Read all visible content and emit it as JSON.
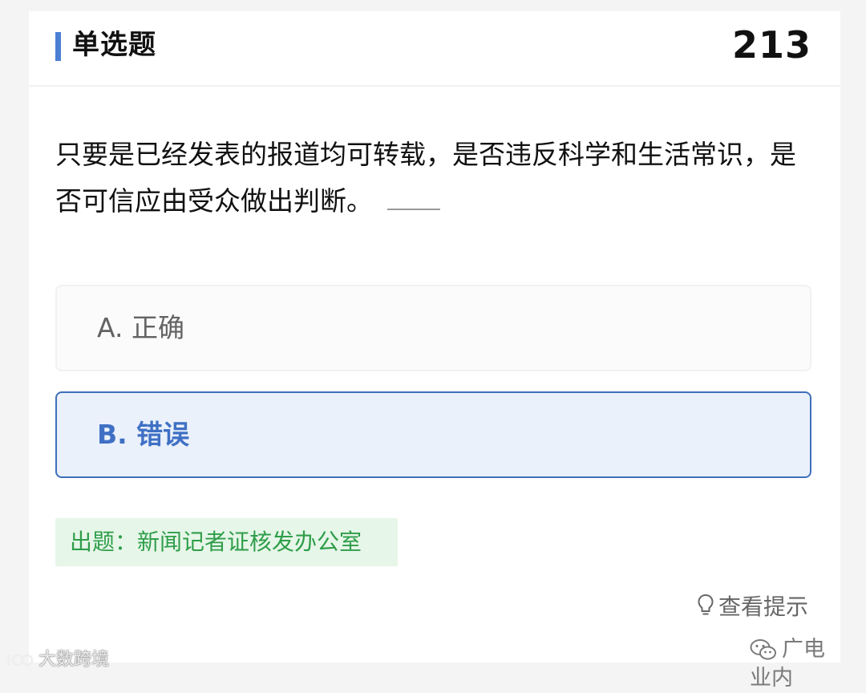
{
  "header": {
    "title": "单选题",
    "question_number": "213"
  },
  "question": {
    "text": "只要是已经发表的报道均可转载，是否违反科学和生活常识，是否可信应由受众做出判断。"
  },
  "options": [
    {
      "label": "A. 正确",
      "selected": false
    },
    {
      "label": "B. 错误",
      "selected": true
    }
  ],
  "source": {
    "text": "出题：新闻记者证核发办公室"
  },
  "hint": {
    "label": "查看提示",
    "icon": "lightbulb-icon"
  },
  "watermarks": {
    "wechat": "广电业内",
    "corner": "大数跨境"
  },
  "colors": {
    "accent": "#4a7fd3",
    "selected_border": "#3f6fba",
    "selected_bg": "#eaf1fb",
    "source_green": "#2f9e4a",
    "source_bg": "#e6f6e8"
  }
}
